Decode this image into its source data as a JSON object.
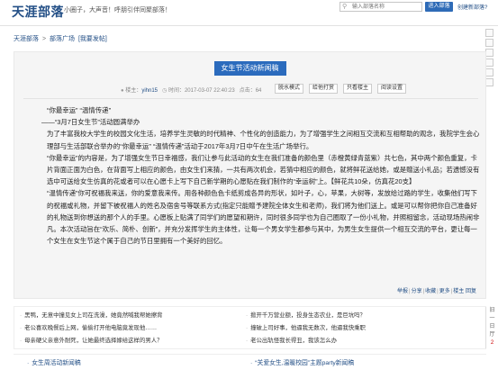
{
  "header": {
    "logo": "天涯部落",
    "slogan": "小圈子，大声音！呼朋引伴同聚部落！",
    "search_placeholder": "输入部落名称",
    "enter_button": "进入部落",
    "create_link": "创建新部落?"
  },
  "breadcrumb": {
    "home": "天涯部落",
    "sep": ">",
    "square": "部落广场",
    "post_new": "[我要发帖]"
  },
  "post": {
    "title": "女生节活动新闻稿",
    "author_label": "楼主：",
    "author": "yihn15",
    "time_label": "时间：",
    "time": "2017-03-07 22:40:23",
    "views_label": "点击：",
    "views": "64",
    "buttons": [
      "脱水模式",
      "给他打赏",
      "只看楼主",
      "阅读设置"
    ],
    "paragraphs": [
      "“你最幸运” “温情传递”",
      "——“3月7日女生节”活动圆满举办",
      "为了丰富我校大学生的校园文化生活，培养学生灵敏的时代精神、个性化的创造能力，为了增强学生之间相互交流和互相帮助的观念，我院学生会心理部与生活部联合举办的“你最幸运” “温情传递”活动于2017年3月7日中午在生活广场举行。",
      "“你最幸运”的内容是，为了增强女生节日幸福感，我们让参与此活动的女生在我们准备的颜色里（赤橙黄绿青蓝紫）共七色，其中两个颜色重复，卡片背面正面为白色，在背面写上相应的颜色，由女生们来猜，一共有两次机会，若猜中相应的颜色，就将鲜花送给她，或是赠送小礼品；若遗憾没有选中可送给女生仿真的花或者可以在心愿卡上写下自己新学期的心愿贴在我们制作的“幸运树”上。【鲜花共10朵，仿真花20支】",
      "“温情传递”你可祝福我来送，你的爱意我来传。用各种颜色色卡纸剪成各异的形状，如叶子，心，苹果，大树等，发放给过路的学生，收集他们写下的祝福或礼物，并留下被祝福人的姓名及宿舍号等联系方式(指定只能赠予建院全体女生和老师)，我们将为他们送上。或是可以帮你把你自己准备好的礼物送到你想送的那个人的手里。心愿板上贴满了同学们的愿望和期许，同时很多同学也为自己圈取了一份小礼物，并照相留念，活动现场热闹非凡。本次活动旨在“欢乐、简朴、创新”，并充分发挥学生的主体性，让每一个男女学生都参与其中，为男生女生提供一个相互交流的平台，更让每一个女生在女生节这个属于自己的节日里拥有一个美好的回忆。"
    ],
    "actions": [
      "举报",
      "分享",
      "收藏",
      "更多",
      "楼主",
      "回复"
    ]
  },
  "related": {
    "left": [
      "黑鸭，无意中撞见女上司在洗澡，她竟然喊我帮她擦背",
      "老公喜欢晚餐后上网，偷偷打开他电脑竟发现他……",
      "母亲硬父亲意外耐死，让她最终选择嫁给这样的男人？"
    ],
    "right": [
      "掀开千万营业额，投身生态农业，是巨坑吗？",
      "撞破上司好事，他逼我无数次，他逼我快乘职",
      "老公出轨怪我长得丑，我该怎么办"
    ],
    "side": [
      "旧",
      "一",
      "日",
      "厅",
      "之",
      "2"
    ]
  },
  "bottom": {
    "left": "女生周活动新闻稿",
    "right": "“关爱女生,温暖校园”主题party新闻稿"
  }
}
